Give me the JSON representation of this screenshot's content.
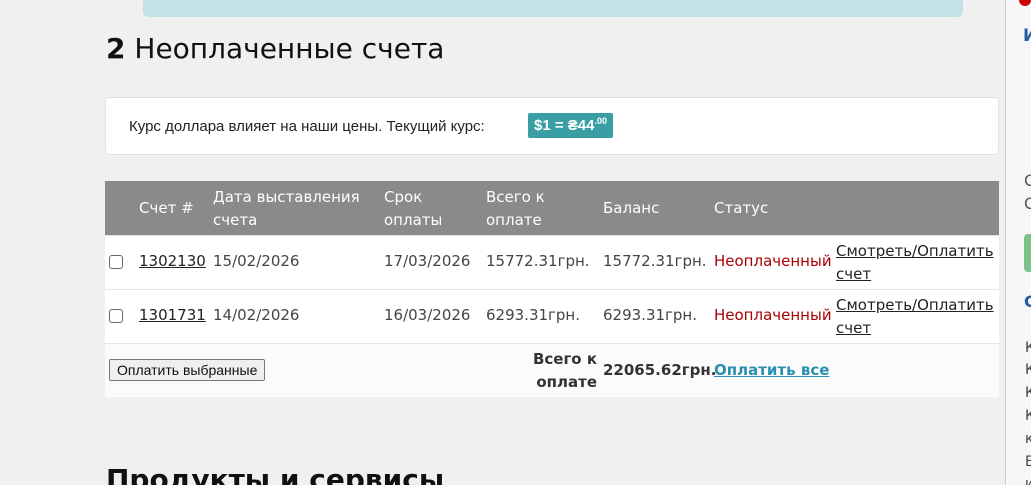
{
  "header": {
    "invoice_count": "2",
    "title": "Неоплаченные счета"
  },
  "rate": {
    "text": "Курс доллара влияет на наши цены. Текущий курс:",
    "badge_main": "$1 = ₴44",
    "badge_cents": ".00"
  },
  "table": {
    "headers": {
      "invoice": "Счет #",
      "issued": "Дата выставления счета",
      "due": "Срок оплаты",
      "total": "Всего к оплате",
      "balance": "Баланс",
      "status": "Статус"
    },
    "rows": [
      {
        "invoice": "1302130",
        "issued": "15/02/2026",
        "due": "17/03/2026",
        "total": "15772.31грн.",
        "balance": "15772.31грн.",
        "status": "Неоплаченный",
        "action": "Смотреть/Оплатить счет"
      },
      {
        "invoice": "1301731",
        "issued": "14/02/2026",
        "due": "16/03/2026",
        "total": "6293.31грн.",
        "balance": "6293.31грн.",
        "status": "Неоплаченный",
        "action": "Смотреть/Оплатить счет"
      }
    ],
    "footer": {
      "pay_selected": "Оплатить выбранные",
      "total_label": "Всего к оплате",
      "total_amount": "22065.62грн.",
      "pay_all": "Оплатить все"
    }
  },
  "next_section": {
    "title": "Продукты и сервисы"
  },
  "sidebar": {
    "heading": "И",
    "letters_o": [
      "С",
      "С"
    ],
    "letter_blue": "С",
    "letters_k": [
      "К",
      "К",
      "К",
      "К",
      "к",
      "Е",
      "и"
    ]
  }
}
